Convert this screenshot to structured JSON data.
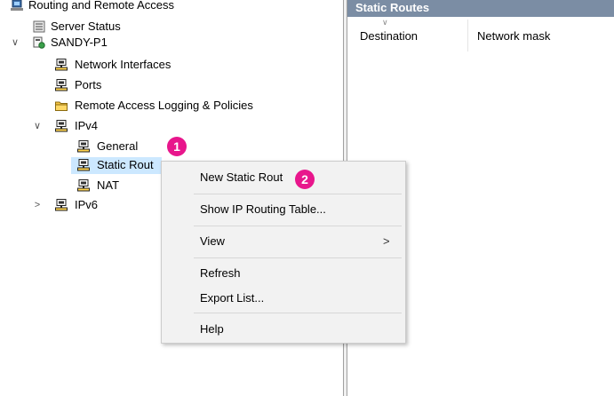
{
  "tree": {
    "root": "Routing and Remote Access",
    "server_status": "Server Status",
    "server": "SANDY-P1",
    "network_interfaces": "Network Interfaces",
    "ports": "Ports",
    "remote_access": "Remote Access Logging & Policies",
    "ipv4": "IPv4",
    "general": "General",
    "static_routes": "Static Rout",
    "nat": "NAT",
    "ipv6": "IPv6"
  },
  "right_pane": {
    "title": "Static Routes",
    "columns": [
      "Destination",
      "Network mask"
    ]
  },
  "context_menu": {
    "items": [
      "New Static Rout",
      "Show IP Routing Table...",
      "View",
      "Refresh",
      "Export List...",
      "Help"
    ],
    "submenu_arrow": ">"
  },
  "callouts": [
    "1",
    "2"
  ],
  "colors": {
    "selection": "#cce8ff",
    "header_bar": "#7b8da4",
    "callout": "#e8168c",
    "menu_bg": "#f2f2f2"
  },
  "icons": {
    "root": "network-server-icon",
    "server_status": "server-list-icon",
    "server": "computer-icon",
    "node": "routing-node-icon",
    "folder": "folder-icon"
  }
}
